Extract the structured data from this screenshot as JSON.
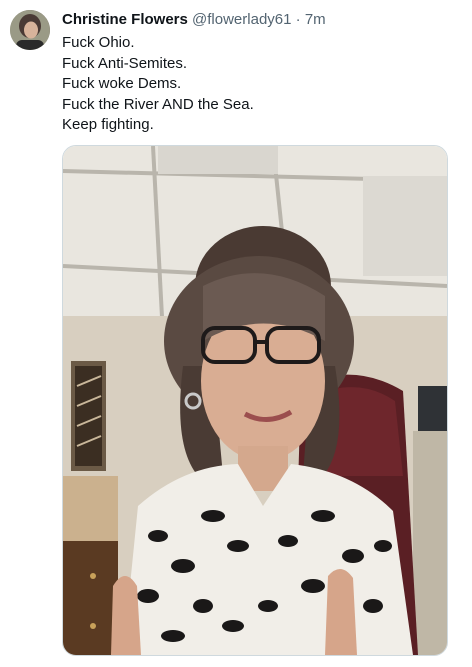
{
  "author": {
    "name": "Christine Flowers",
    "handle": "@flowerlady61",
    "separator": "·",
    "timestamp": "7m"
  },
  "tweet": {
    "lines": [
      "Fuck Ohio.",
      "Fuck Anti-Semites.",
      "Fuck woke Dems.",
      "Fuck the River AND the Sea.",
      "Keep fighting."
    ]
  },
  "media": {
    "type": "photo",
    "icon": "photo-icon"
  },
  "colors": {
    "text": "#0f1419",
    "secondary": "#536471",
    "border": "#cfd9de"
  }
}
